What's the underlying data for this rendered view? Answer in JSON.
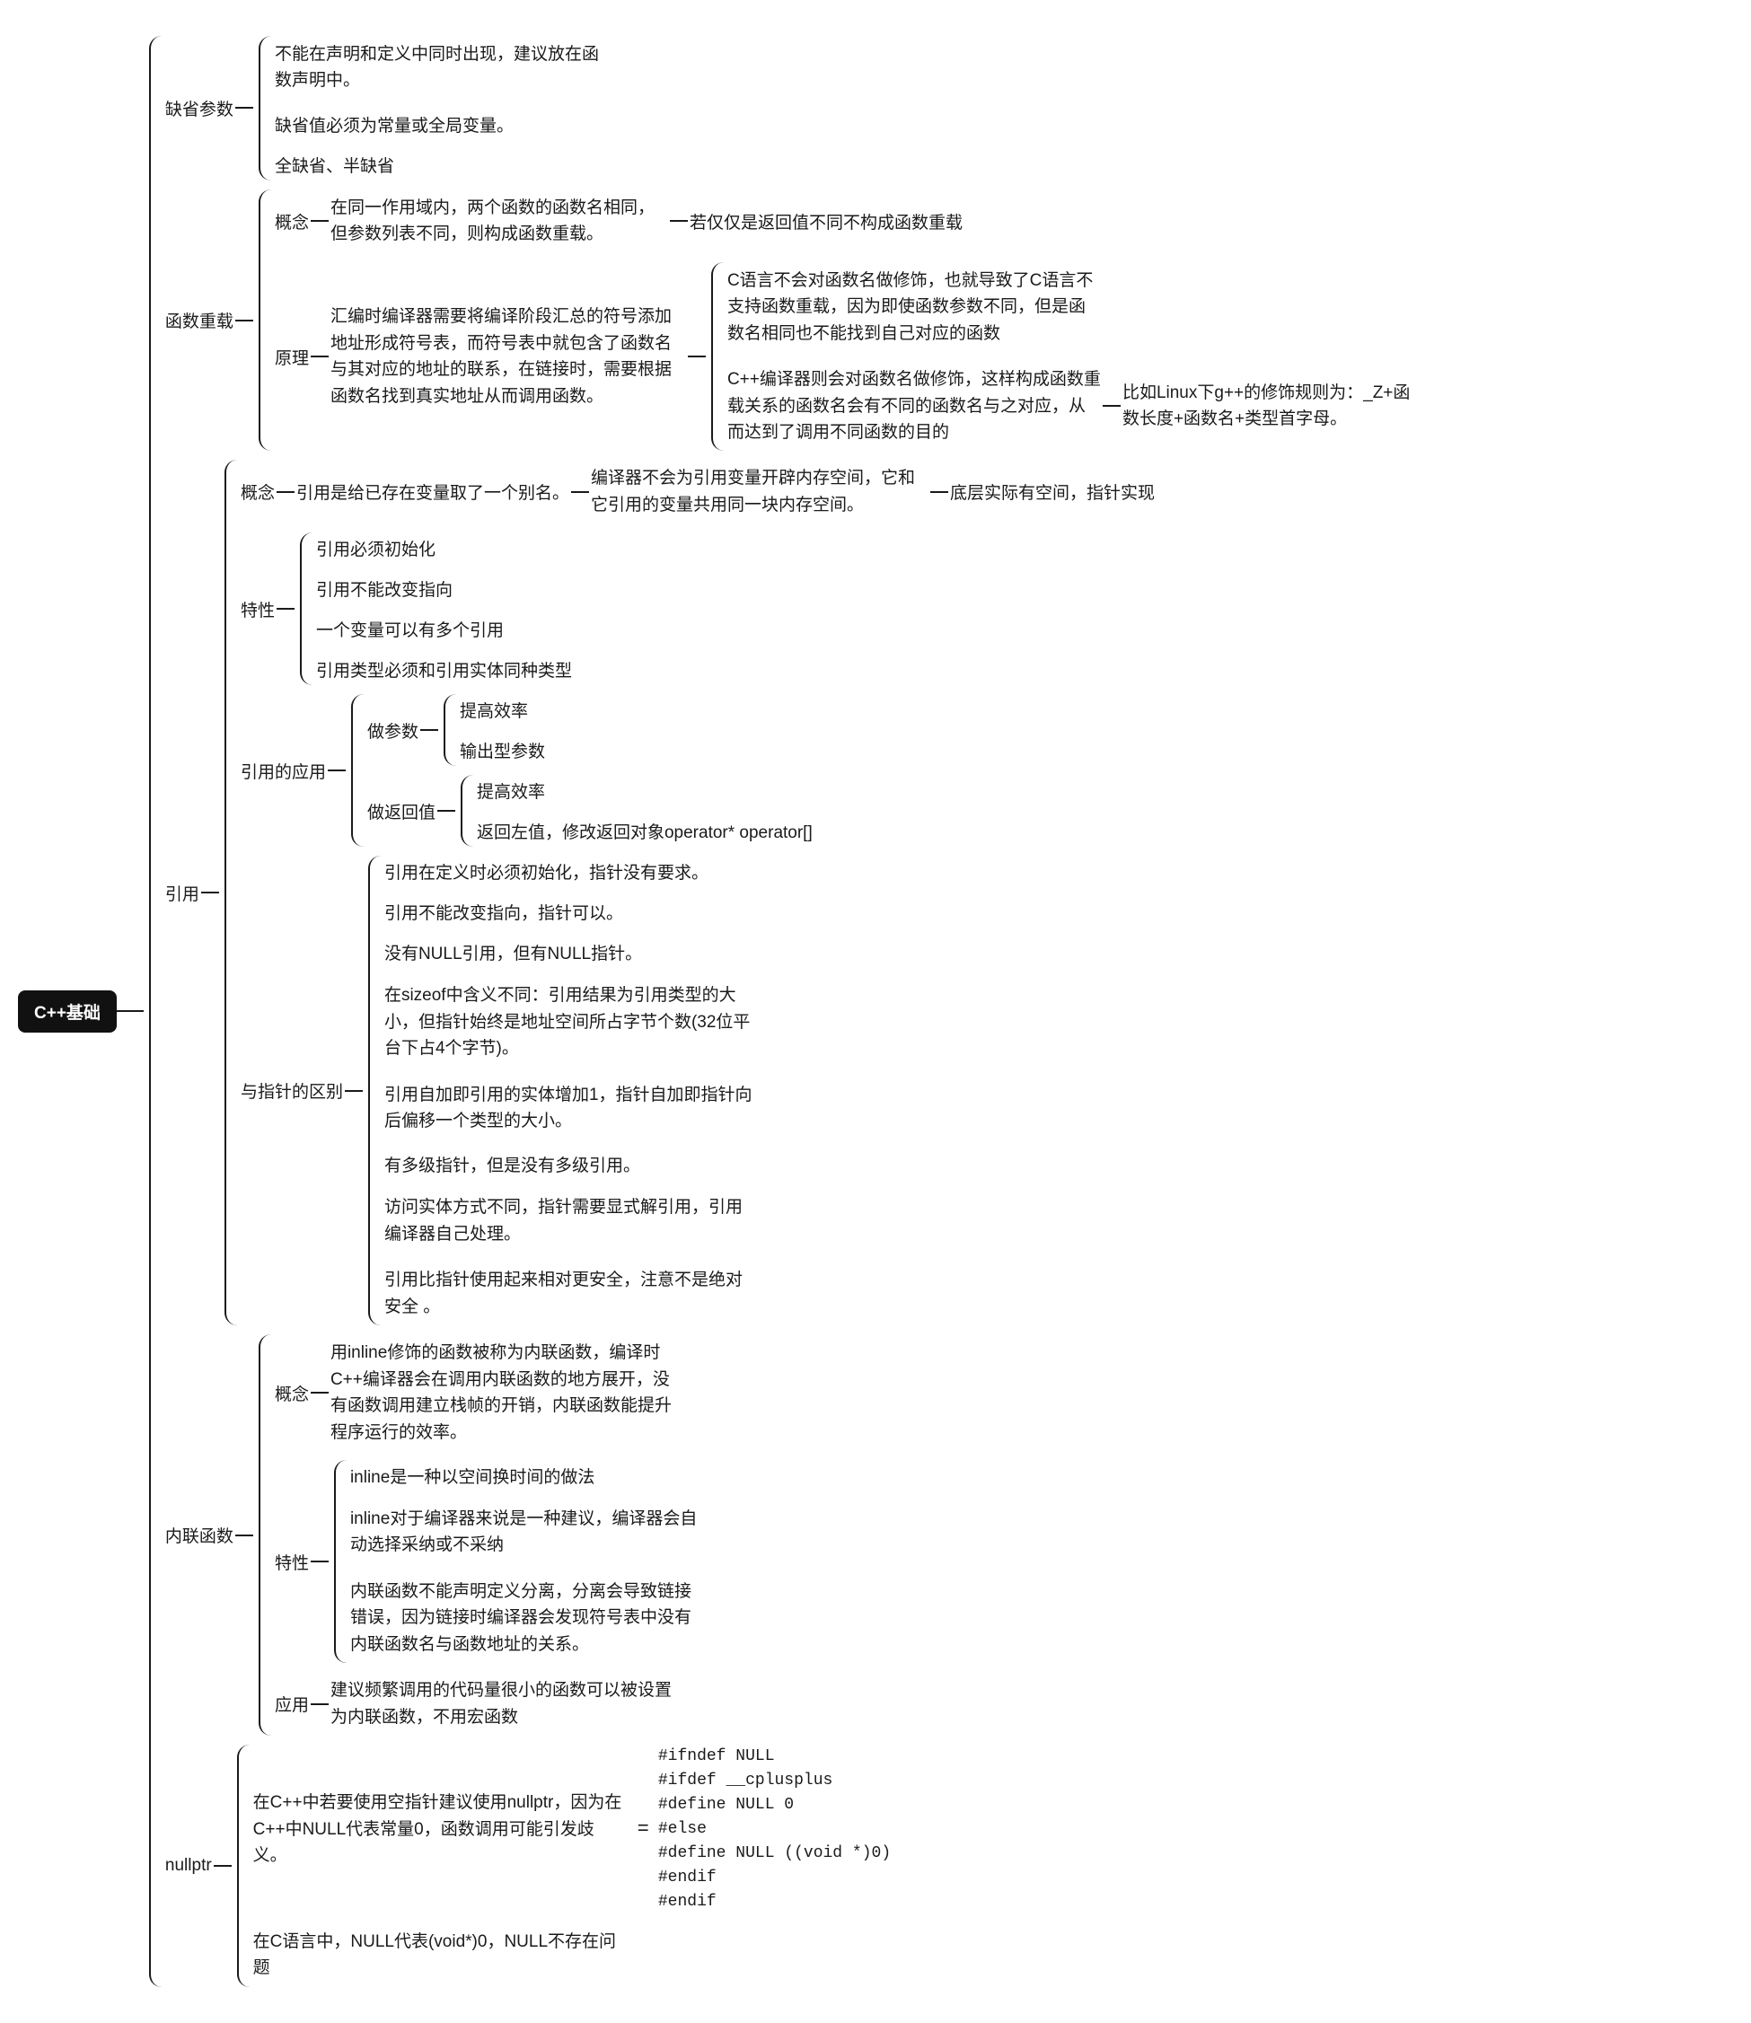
{
  "root": "C++基础",
  "t": {
    "qsCs": "缺省参数",
    "qs1": "不能在声明和定义中同时出现，建议放在函数声明中。",
    "qs2": "缺省值必须为常量或全局变量。",
    "qs3": "全缺省、半缺省",
    "olHead": "函数重载",
    "olGn": "概念",
    "olGnTxt": "在同一作用域内，两个函数的函数名相同，但参数列表不同，则构成函数重载。",
    "olGnSub": "若仅仅是返回值不同不构成函数重载",
    "olYl": "原理",
    "olYlTxt": "汇编时编译器需要将编译阶段汇总的符号添加地址形成符号表，而符号表中就包含了函数名与其对应的地址的联系，在链接时，需要根据函数名找到真实地址从而调用函数。",
    "olYlS1": "C语言不会对函数名做修饰，也就导致了C语言不支持函数重载，因为即使函数参数不同，但是函数名相同也不能找到自己对应的函数",
    "olYlS2": "C++编译器则会对函数名做修饰，这样构成函数重载关系的函数名会有不同的函数名与之对应，从而达到了调用不同函数的目的",
    "olYlS2Sub": "比如Linux下g++的修饰规则为：_Z+函数长度+函数名+类型首字母。",
    "refHead": "引用",
    "refGn": "概念",
    "refGnTxt": "引用是给已存在变量取了一个别名。",
    "refGnSub1": "编译器不会为引用变量开辟内存空间，它和它引用的变量共用同一块内存空间。",
    "refGnSub2": "底层实际有空间，指针实现",
    "refTx": "特性",
    "refTx1": "引用必须初始化",
    "refTx2": "引用不能改变指向",
    "refTx3": "一个变量可以有多个引用",
    "refTx4": "引用类型必须和引用实体同种类型",
    "refApp": "引用的应用",
    "refApp1": "做参数",
    "refApp1a": "提高效率",
    "refApp1b": "输出型参数",
    "refApp2": "做返回值",
    "refApp2a": "提高效率",
    "refApp2b": "返回左值，修改返回对象operator* operator[]",
    "refDiff": "与指针的区别",
    "refD1": "引用在定义时必须初始化，指针没有要求。",
    "refD2": "引用不能改变指向，指针可以。",
    "refD3": "没有NULL引用，但有NULL指针。",
    "refD4": "在sizeof中含义不同：引用结果为引用类型的大小，但指针始终是地址空间所占字节个数(32位平台下占4个字节)。",
    "refD5": "引用自加即引用的实体增加1，指针自加即指针向后偏移一个类型的大小。",
    "refD6": "有多级指针，但是没有多级引用。",
    "refD7": "访问实体方式不同，指针需要显式解引用，引用编译器自己处理。",
    "refD8": "引用比指针使用起来相对更安全，注意不是绝对安全 。",
    "inlHead": "内联函数",
    "inlGn": "概念",
    "inlGnTxt": "用inline修饰的函数被称为内联函数，编译时C++编译器会在调用内联函数的地方展开，没有函数调用建立栈帧的开销，内联函数能提升程序运行的效率。",
    "inlTx": "特性",
    "inlTx1": "inline是一种以空间换时间的做法",
    "inlTx2": "inline对于编译器来说是一种建议，编译器会自动选择采纳或不采纳",
    "inlTx3": "内联函数不能声明定义分离，分离会导致链接错误，因为链接时编译器会发现符号表中没有内联函数名与函数地址的关系。",
    "inlApp": "应用",
    "inlAppTxt": "建议频繁调用的代码量很小的函数可以被设置为内联函数，不用宏函数",
    "nullHead": "nullptr",
    "null1": "在C++中若要使用空指针建议使用nullptr，因为在C++中NULL代表常量0，函数调用可能引发歧义。",
    "null2": "在C语言中，NULL代表(void*)0，NULL不存在问题",
    "nullCode": "#ifndef NULL\n#ifdef __cplusplus\n#define NULL 0\n#else\n#define NULL ((void *)0)\n#endif\n#endif"
  }
}
